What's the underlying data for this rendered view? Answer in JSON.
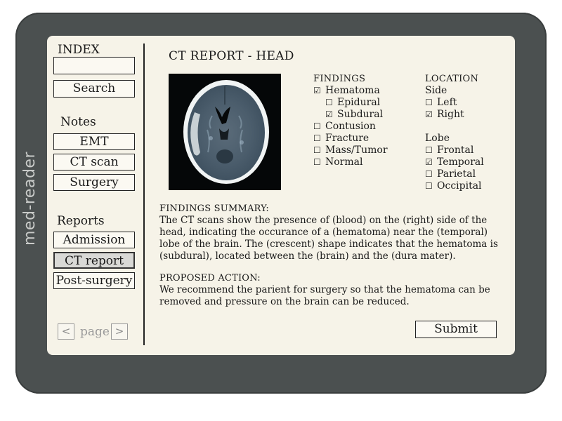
{
  "device": {
    "label": "med-reader"
  },
  "sidebar": {
    "index_label": "INDEX",
    "search_value": "",
    "search_button": "Search",
    "notes_label": "Notes",
    "notes_items": [
      "EMT",
      "CT scan",
      "Surgery"
    ],
    "reports_label": "Reports",
    "reports_items": [
      "Admission",
      "CT report",
      "Post-surgery"
    ],
    "active_report": "CT report",
    "pager": {
      "prev": "<",
      "label": "page",
      "next": ">"
    }
  },
  "main": {
    "title": "CT REPORT - HEAD",
    "findings": {
      "header": "FINDINGS",
      "hematoma": {
        "label": "Hematoma",
        "checked": true
      },
      "epidural": {
        "label": "Epidural",
        "checked": false
      },
      "subdural": {
        "label": "Subdural",
        "checked": true
      },
      "contusion": {
        "label": "Contusion",
        "checked": false
      },
      "fracture": {
        "label": "Fracture",
        "checked": false
      },
      "mass": {
        "label": "Mass/Tumor",
        "checked": false
      },
      "normal": {
        "label": "Normal",
        "checked": false
      }
    },
    "location": {
      "header": "LOCATION",
      "side_label": "Side",
      "left": {
        "label": "Left",
        "checked": false
      },
      "right": {
        "label": "Right",
        "checked": true
      },
      "lobe_label": "Lobe",
      "frontal": {
        "label": "Frontal",
        "checked": false
      },
      "temporal": {
        "label": "Temporal",
        "checked": true
      },
      "parietal": {
        "label": "Parietal",
        "checked": false
      },
      "occipital": {
        "label": "Occipital",
        "checked": false
      }
    },
    "summary": {
      "header": "FINDINGS SUMMARY:",
      "text": "The CT scans show the presence of (blood) on the (right) side of the head, indicating the occurance of a (hematoma) near the (temporal) lobe of the brain. The (crescent) shape indicates that the hematoma is (subdural), located between the (brain) and the (dura mater)."
    },
    "action": {
      "header": "PROPOSED ACTION:",
      "text": "We recommend the parient for surgery so that the hematoma can be removed and pressure on the brain can be reduced."
    },
    "submit_label": "Submit"
  }
}
